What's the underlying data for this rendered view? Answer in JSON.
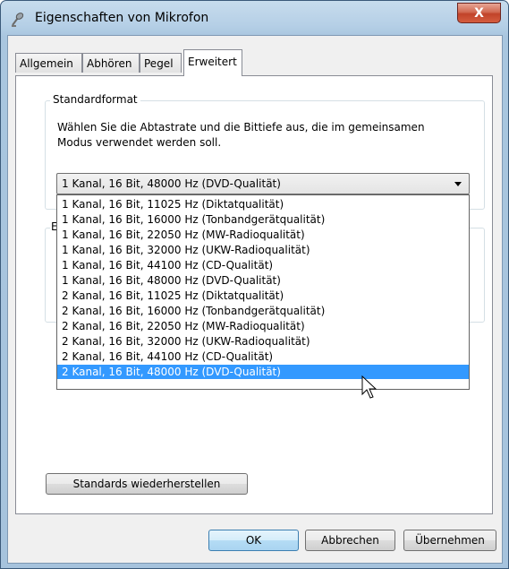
{
  "window": {
    "title": "Eigenschaften von Mikrofon",
    "close_label": "X"
  },
  "tabs": [
    {
      "label": "Allgemein",
      "active": false
    },
    {
      "label": "Abhören",
      "active": false
    },
    {
      "label": "Pegel",
      "active": false
    },
    {
      "label": "Erweitert",
      "active": true
    }
  ],
  "standardformat": {
    "group_label": "Standardformat",
    "description": "Wählen Sie die Abtastrate und die Bittiefe aus, die im gemeinsamen Modus verwendet werden soll.",
    "selected_value": "1 Kanal, 16 Bit, 48000 Hz (DVD-Qualität)",
    "options": [
      "1 Kanal, 16 Bit, 11025 Hz (Diktatqualität)",
      "1 Kanal, 16 Bit, 16000 Hz (Tonbandgerätqualität)",
      "1 Kanal, 16 Bit, 22050 Hz (MW-Radioqualität)",
      "1 Kanal, 16 Bit, 32000 Hz (UKW-Radioqualität)",
      "1 Kanal, 16 Bit, 44100 Hz (CD-Qualität)",
      "1 Kanal, 16 Bit, 48000 Hz (DVD-Qualität)",
      "2 Kanal, 16 Bit, 11025 Hz (Diktatqualität)",
      "2 Kanal, 16 Bit, 16000 Hz (Tonbandgerätqualität)",
      "2 Kanal, 16 Bit, 22050 Hz (MW-Radioqualität)",
      "2 Kanal, 16 Bit, 32000 Hz (UKW-Radioqualität)",
      "2 Kanal, 16 Bit, 44100 Hz (CD-Qualität)",
      "2 Kanal, 16 Bit, 48000 Hz (DVD-Qualität)"
    ],
    "highlighted_index": 11
  },
  "exclusive_group": {
    "label_visible": "E"
  },
  "buttons": {
    "restore_defaults": "Standards wiederherstellen",
    "ok": "OK",
    "cancel": "Abbrechen",
    "apply": "Übernehmen"
  },
  "icons": {
    "window_icon": "microphone-icon",
    "cursor": "mouse-pointer-icon"
  },
  "colors": {
    "selection": "#3399ff",
    "close_button": "#c1432a"
  }
}
